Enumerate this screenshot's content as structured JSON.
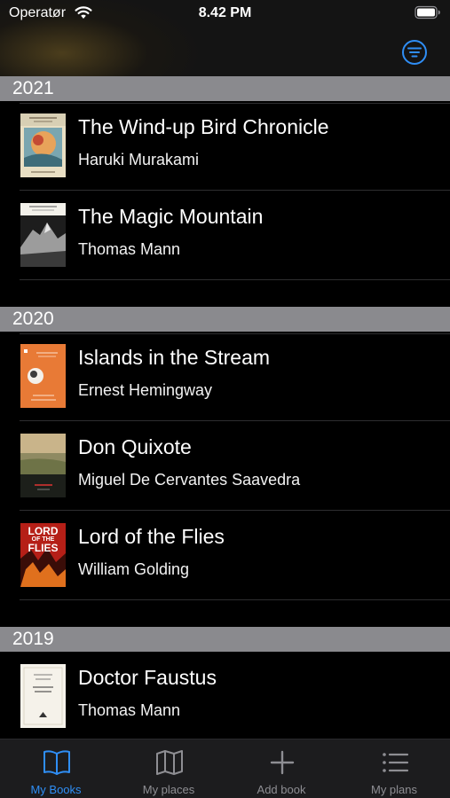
{
  "status_bar": {
    "carrier": "Operatør",
    "time": "8.42 PM"
  },
  "colors": {
    "accent": "#2f8ef5",
    "section_header_bg": "#8a8a8e",
    "tab_bar_bg": "#1c1c1e",
    "inactive_tab": "#8e8e93"
  },
  "filter_button": {
    "icon": "filter-lines-icon"
  },
  "sections": [
    {
      "year": "2021",
      "books": [
        {
          "title": "The Wind-up Bird Chronicle",
          "author": "Haruki Murakami"
        },
        {
          "title": "The Magic Mountain",
          "author": "Thomas Mann"
        }
      ]
    },
    {
      "year": "2020",
      "books": [
        {
          "title": "Islands in the Stream",
          "author": "Ernest Hemingway"
        },
        {
          "title": "Don Quixote",
          "author": "Miguel De Cervantes Saavedra"
        },
        {
          "title": "Lord of the Flies",
          "author": "William Golding"
        }
      ]
    },
    {
      "year": "2019",
      "books": [
        {
          "title": "Doctor Faustus",
          "author": "Thomas Mann"
        }
      ]
    }
  ],
  "covers": {
    "lord_of_the_flies_text_1": "LORD",
    "lord_of_the_flies_text_2": "OF THE",
    "lord_of_the_flies_text_3": "FLIES"
  },
  "tab_bar": {
    "tabs": [
      {
        "label": "My Books",
        "icon": "open-book-icon",
        "active": true
      },
      {
        "label": "My places",
        "icon": "map-icon",
        "active": false
      },
      {
        "label": "Add book",
        "icon": "plus-icon",
        "active": false
      },
      {
        "label": "My plans",
        "icon": "list-icon",
        "active": false
      }
    ]
  }
}
